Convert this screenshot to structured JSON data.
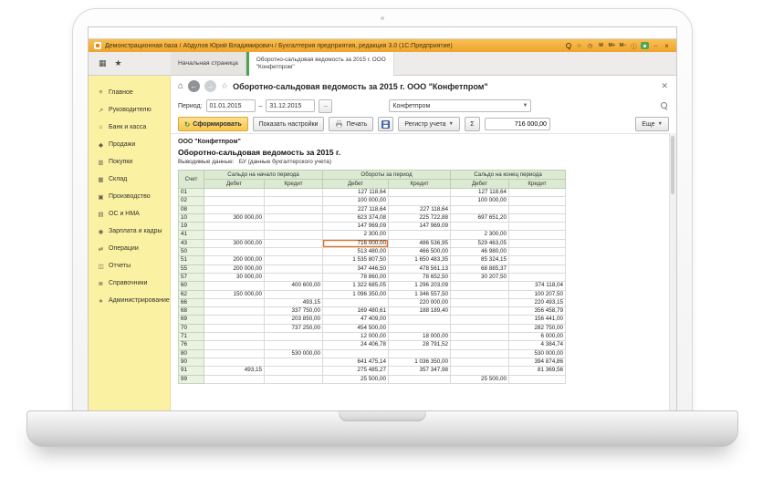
{
  "colors": {
    "titlebar_amber": "#f2a93b",
    "sidebar_yellow": "#fbf1a3",
    "table_header_green": "#dcead3",
    "selection_orange": "#e2731d",
    "active_tab_accent": "#4aa24e"
  },
  "window": {
    "title": "Демонстрационная база / Абдулов Юрий Владимирович / Бухгалтерия предприятия, редакция 3.0 (1С:Предприятие)",
    "icons": [
      "search",
      "favorites",
      "history",
      "memory",
      "memory-plus",
      "memory-minus",
      "info",
      "support",
      "minimize",
      "close"
    ]
  },
  "tabs": [
    {
      "label": "Начальная страница"
    },
    {
      "label": "Оборотно-сальдовая ведомость за 2015 г.  ООО \"Конфетпром\""
    }
  ],
  "sidebar": {
    "items": [
      {
        "id": "main",
        "label": "Главное"
      },
      {
        "id": "manager",
        "label": "Руководителю"
      },
      {
        "id": "bank",
        "label": "Банк и касса"
      },
      {
        "id": "sales",
        "label": "Продажи"
      },
      {
        "id": "purchases",
        "label": "Покупки"
      },
      {
        "id": "warehouse",
        "label": "Склад"
      },
      {
        "id": "production",
        "label": "Производство"
      },
      {
        "id": "assets",
        "label": "ОС и НМА"
      },
      {
        "id": "hr",
        "label": "Зарплата и кадры"
      },
      {
        "id": "operations",
        "label": "Операции"
      },
      {
        "id": "reports",
        "label": "Отчеты"
      },
      {
        "id": "catalogs",
        "label": "Справочники"
      },
      {
        "id": "admin",
        "label": "Администрирование"
      }
    ]
  },
  "form": {
    "title": "Оборотно-сальдовая ведомость за 2015 г. ООО \"Конфетпром\"",
    "period": {
      "label": "Период:",
      "from": "01.01.2015",
      "sep": "–",
      "to": "31.12.2015",
      "dots": "..."
    },
    "org": "Конфетпром"
  },
  "toolbar": {
    "generate": "Сформировать",
    "show_settings": "Показать настройки",
    "print_label": "Печать",
    "register": "Регистр учета",
    "sigma": "Σ",
    "sum_value": "716 000,00",
    "more": "Еще"
  },
  "report": {
    "company": "ООО \"Конфетпром\"",
    "heading": "Оборотно-сальдовая ведомость за 2015 г.",
    "note_label": "Выводимые данные:",
    "note_value": "БУ (данные бухгалтерского учета)"
  },
  "table": {
    "col_account": "Счет",
    "groups": [
      "Сальдо на начало периода",
      "Обороты за период",
      "Сальдо на конец периода"
    ],
    "sub": [
      "Дебет",
      "Кредит"
    ],
    "selected": {
      "account": "43",
      "value_index": 2
    },
    "rows": [
      {
        "account": "01",
        "values": [
          "",
          "",
          "127 118,64",
          "",
          "127 118,64",
          ""
        ]
      },
      {
        "account": "02",
        "values": [
          "",
          "",
          "100 000,00",
          "",
          "100 000,00",
          ""
        ]
      },
      {
        "account": "08",
        "values": [
          "",
          "",
          "227 118,64",
          "227 118,64",
          "",
          ""
        ]
      },
      {
        "account": "10",
        "values": [
          "300 000,00",
          "",
          "623 374,08",
          "225 722,88",
          "697 651,20",
          ""
        ]
      },
      {
        "account": "19",
        "values": [
          "",
          "",
          "147 969,09",
          "147 969,09",
          "",
          ""
        ]
      },
      {
        "account": "41",
        "values": [
          "",
          "",
          "2 300,00",
          "",
          "2 300,00",
          ""
        ]
      },
      {
        "account": "43",
        "values": [
          "300 000,00",
          "",
          "716 000,00",
          "486 536,95",
          "529 463,05",
          ""
        ]
      },
      {
        "account": "50",
        "values": [
          "",
          "",
          "513 480,00",
          "466 500,00",
          "46 980,00",
          ""
        ]
      },
      {
        "account": "51",
        "values": [
          "200 000,00",
          "",
          "1 535 807,50",
          "1 650 483,35",
          "85 324,15",
          ""
        ]
      },
      {
        "account": "55",
        "values": [
          "200 000,00",
          "",
          "347 446,50",
          "478 561,13",
          "68 885,37",
          ""
        ]
      },
      {
        "account": "57",
        "values": [
          "30 000,00",
          "",
          "78 860,00",
          "78 652,50",
          "30 207,50",
          ""
        ]
      },
      {
        "account": "60",
        "values": [
          "",
          "400 600,00",
          "1 322 685,05",
          "1 296 203,09",
          "",
          "374 118,04"
        ]
      },
      {
        "account": "62",
        "values": [
          "150 000,00",
          "",
          "1 096 350,00",
          "1 346 557,50",
          "",
          "100 207,50"
        ]
      },
      {
        "account": "66",
        "values": [
          "",
          "493,15",
          "",
          "220 000,00",
          "",
          "220 493,15"
        ]
      },
      {
        "account": "68",
        "values": [
          "",
          "337 750,00",
          "169 480,61",
          "188 189,40",
          "",
          "356 458,79"
        ]
      },
      {
        "account": "69",
        "values": [
          "",
          "203 850,00",
          "47 409,00",
          "",
          "",
          "156 441,00"
        ]
      },
      {
        "account": "70",
        "values": [
          "",
          "737 250,00",
          "454 500,00",
          "",
          "",
          "282 750,00"
        ]
      },
      {
        "account": "71",
        "values": [
          "",
          "",
          "12 000,00",
          "18 000,00",
          "",
          "6 000,00"
        ]
      },
      {
        "account": "76",
        "values": [
          "",
          "",
          "24 406,78",
          "28 791,52",
          "",
          "4 384,74"
        ]
      },
      {
        "account": "80",
        "values": [
          "",
          "530 000,00",
          "",
          "",
          "",
          "530 000,00"
        ]
      },
      {
        "account": "90",
        "values": [
          "",
          "",
          "641 475,14",
          "1 036 350,00",
          "",
          "394 874,86"
        ]
      },
      {
        "account": "91",
        "values": [
          "493,15",
          "",
          "275 485,27",
          "357 347,98",
          "",
          "81 369,56"
        ]
      },
      {
        "account": "99",
        "values": [
          "",
          "",
          "25 500,00",
          "",
          "25 500,00",
          ""
        ]
      }
    ]
  }
}
